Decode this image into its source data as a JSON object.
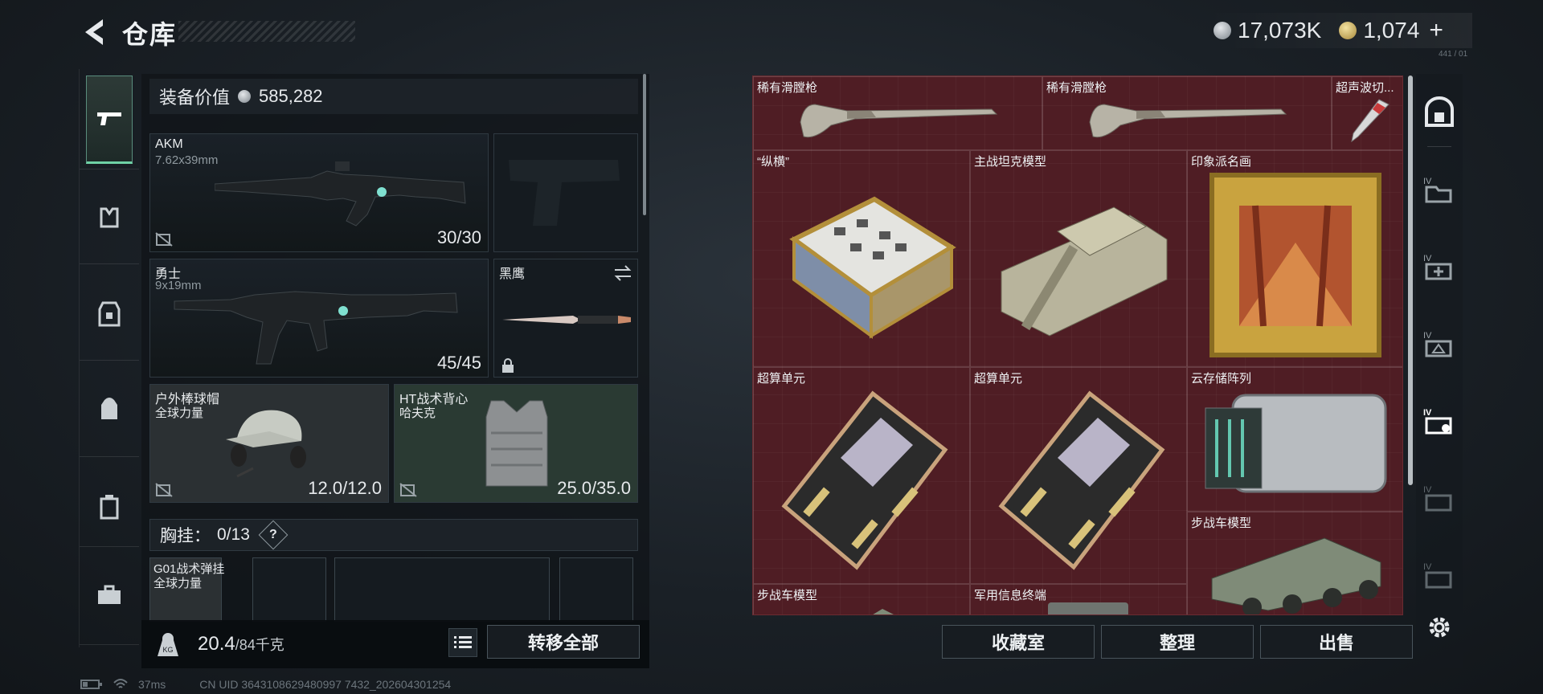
{
  "header": {
    "title": "仓库",
    "currency_silver": "17,073K",
    "currency_gold": "1,074",
    "currency_plus": "+",
    "corner_note": "441 / 01"
  },
  "equipment": {
    "value_label": "装备价值",
    "value": "585,282",
    "slots": [
      {
        "name": "AKM",
        "sub": "7.62x39mm",
        "ammo": "30/30"
      },
      {
        "name": "勇士",
        "sub": "9x19mm",
        "ammo": "45/45"
      },
      {
        "name": "黑鹰",
        "sub": "",
        "ammo": ""
      },
      {
        "name": "户外棒球帽",
        "sub": "全球力量",
        "ammo": "12.0/12.0"
      },
      {
        "name": "HT战术背心",
        "sub": "哈夫克",
        "ammo": "25.0/35.0"
      }
    ],
    "chest_label": "胸挂：",
    "chest_count": "0/13",
    "chest_help": "?",
    "chest_item_name": "G01战术弹挂",
    "chest_item_sub": "全球力量"
  },
  "weight": {
    "current": "20.4",
    "max": "/84千克"
  },
  "buttons": {
    "transfer_all": "转移全部",
    "collection": "收藏室",
    "sort": "整理",
    "sell": "出售"
  },
  "storage": {
    "items": [
      {
        "label": "稀有滑膛枪"
      },
      {
        "label": "稀有滑膛枪"
      },
      {
        "label": "超声波切..."
      },
      {
        "label": "“纵横”"
      },
      {
        "label": "主战坦克模型"
      },
      {
        "label": "印象派名画"
      },
      {
        "label": "超算单元"
      },
      {
        "label": "超算单元"
      },
      {
        "label": "云存储阵列"
      },
      {
        "label": "步战车模型"
      },
      {
        "label": "步战车模型"
      },
      {
        "label": "军用信息终端"
      }
    ]
  },
  "status": {
    "ping": "37ms",
    "uid": "CN UID 3643108629480997 7432_202604301254"
  },
  "colors": {
    "accent_green": "#6fd2a6",
    "storage_bg": "#4b1d22"
  }
}
